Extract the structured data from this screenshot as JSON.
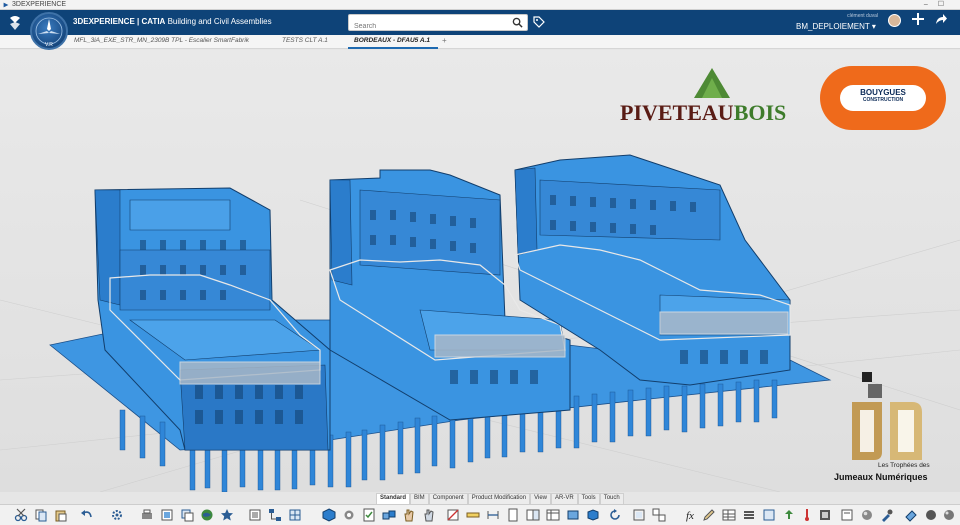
{
  "window": {
    "title": "3DEXPERIENCE"
  },
  "appbar": {
    "brand_bold": "3DEXPERIENCE | CATIA",
    "brand_app": "Building and Civil Assemblies",
    "search_placeholder": "Search",
    "user_name": "clément duval",
    "tenant": "BM_DEPLOIEMENT",
    "compass_version": "V.R"
  },
  "tabs": [
    {
      "label": "MFL_3iA_EXE_STR_MN_2309"
    },
    {
      "label": "B TPL - Escalier SmartFabrik"
    },
    {
      "label": "TESTS CLT A.1"
    },
    {
      "label": "BORDEAUX - DFAU5 A.1",
      "active": true
    }
  ],
  "logos": {
    "piveteau_a": "PIVETEAU",
    "piveteau_b": "BOIS",
    "bouygues_1": "BOUYGUES",
    "bouygues_2": "CONSTRUCTION",
    "trophy_1": "Les Trophées des",
    "trophy_2": "Jumeaux Numériques"
  },
  "workbench_tabs": [
    "Standard",
    "BIM",
    "Component",
    "Product Modification",
    "View",
    "AR-VR",
    "Tools",
    "Touch"
  ],
  "workbench_active": "Tools",
  "colors": {
    "appbar": "#0e4378",
    "model_blue": "#2f8de0",
    "bouygues_orange": "#ef6a1b",
    "piveteau_brown": "#5a1c15",
    "piveteau_green": "#3e7c2b"
  }
}
